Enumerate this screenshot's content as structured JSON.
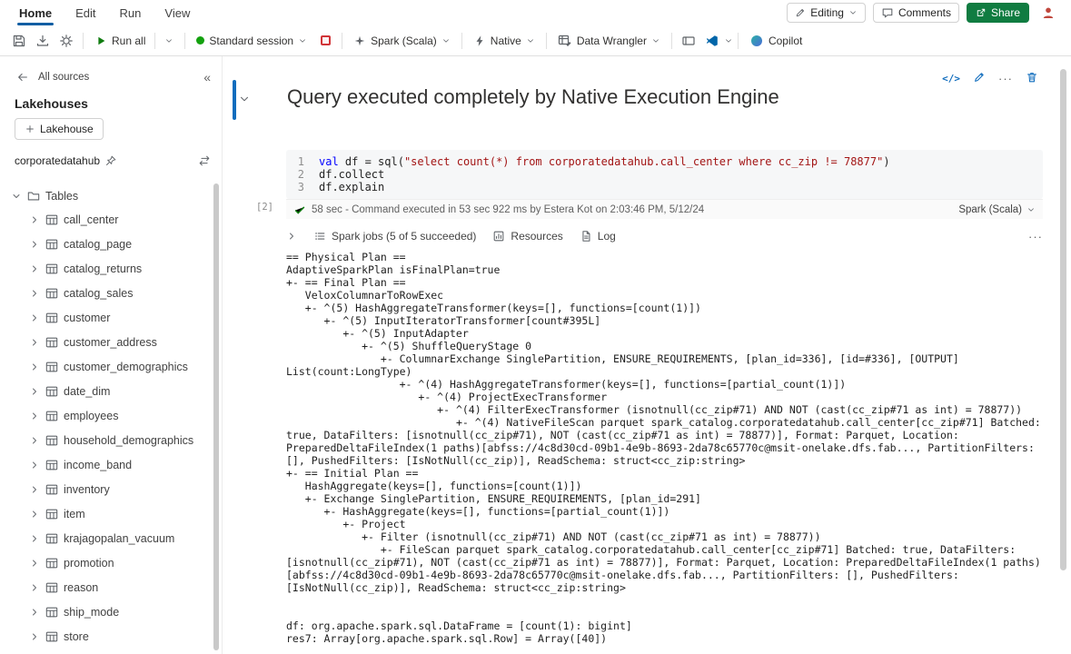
{
  "colors": {
    "accent_blue": "#115ea3",
    "share_green": "#107c41",
    "run_green": "#107c10",
    "session_green": "#13a10e",
    "stop_red": "#d13438",
    "keyword_blue": "#0000ff",
    "string_red": "#a31515"
  },
  "menubar": {
    "items": [
      "Home",
      "Edit",
      "Run",
      "View"
    ],
    "active": "Home",
    "editing": "Editing",
    "comments": "Comments",
    "share": "Share"
  },
  "toolbar": {
    "run_all": "Run all",
    "session": "Standard session",
    "language": "Spark (Scala)",
    "engine": "Native",
    "wrangler": "Data Wrangler",
    "copilot": "Copilot"
  },
  "sidebar": {
    "back": "All sources",
    "collapse": "«",
    "title": "Lakehouses",
    "add": "Lakehouse",
    "lakehouse": "corporatedatahub",
    "root": "Tables",
    "tables": [
      "call_center",
      "catalog_page",
      "catalog_returns",
      "catalog_sales",
      "customer",
      "customer_address",
      "customer_demographics",
      "date_dim",
      "employees",
      "household_demographics",
      "income_band",
      "inventory",
      "item",
      "krajagopalan_vacuum",
      "promotion",
      "reason",
      "ship_mode",
      "store"
    ]
  },
  "cell": {
    "title": "Query executed completely by Native Execution Engine",
    "code_toolbar_code": "</>",
    "execution_index": "[2]",
    "status": "58 sec - Command executed in 53 sec 922 ms by Estera Kot on 2:03:46 PM, 5/12/24",
    "kernel": "Spark (Scala)",
    "tabs": {
      "jobs": "Spark jobs (5 of 5 succeeded)",
      "resources": "Resources",
      "log": "Log"
    },
    "more": "···"
  },
  "code": {
    "lines": [
      {
        "n": "1"
      },
      {
        "n": "2",
        "text": "df.collect"
      },
      {
        "n": "3",
        "text": "df.explain"
      }
    ],
    "line1": {
      "kw": "val",
      "mid": " df = sql(",
      "str": "\"select count(*) from corporatedatahub.call_center where cc_zip != 78877\"",
      "end": ")"
    }
  },
  "output_lines": [
    "== Physical Plan ==",
    "AdaptiveSparkPlan isFinalPlan=true",
    "+- == Final Plan ==",
    "   VeloxColumnarToRowExec",
    "   +- ^(5) HashAggregateTransformer(keys=[], functions=[count(1)])",
    "      +- ^(5) InputIteratorTransformer[count#395L]",
    "         +- ^(5) InputAdapter",
    "            +- ^(5) ShuffleQueryStage 0",
    "               +- ColumnarExchange SinglePartition, ENSURE_REQUIREMENTS, [plan_id=336], [id=#336], [OUTPUT] List(count:LongType)",
    "                  +- ^(4) HashAggregateTransformer(keys=[], functions=[partial_count(1)])",
    "                     +- ^(4) ProjectExecTransformer",
    "                        +- ^(4) FilterExecTransformer (isnotnull(cc_zip#71) AND NOT (cast(cc_zip#71 as int) = 78877))",
    "                           +- ^(4) NativeFileScan parquet spark_catalog.corporatedatahub.call_center[cc_zip#71] Batched: true, DataFilters: [isnotnull(cc_zip#71), NOT (cast(cc_zip#71 as int) = 78877)], Format: Parquet, Location: PreparedDeltaFileIndex(1 paths)[abfss://4c8d30cd-09b1-4e9b-8693-2da78c65770c@msit-onelake.dfs.fab..., PartitionFilters: [], PushedFilters: [IsNotNull(cc_zip)], ReadSchema: struct<cc_zip:string>",
    "+- == Initial Plan ==",
    "   HashAggregate(keys=[], functions=[count(1)])",
    "   +- Exchange SinglePartition, ENSURE_REQUIREMENTS, [plan_id=291]",
    "      +- HashAggregate(keys=[], functions=[partial_count(1)])",
    "         +- Project",
    "            +- Filter (isnotnull(cc_zip#71) AND NOT (cast(cc_zip#71 as int) = 78877))",
    "               +- FileScan parquet spark_catalog.corporatedatahub.call_center[cc_zip#71] Batched: true, DataFilters: [isnotnull(cc_zip#71), NOT (cast(cc_zip#71 as int) = 78877)], Format: Parquet, Location: PreparedDeltaFileIndex(1 paths)[abfss://4c8d30cd-09b1-4e9b-8693-2da78c65770c@msit-onelake.dfs.fab..., PartitionFilters: [], PushedFilters: [IsNotNull(cc_zip)], ReadSchema: struct<cc_zip:string>",
    "",
    "",
    "df: org.apache.spark.sql.DataFrame = [count(1): bigint]",
    "res7: Array[org.apache.spark.sql.Row] = Array([40])"
  ]
}
